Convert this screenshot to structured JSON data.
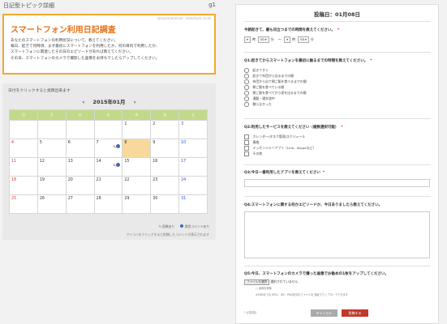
{
  "header": {
    "title": "日記型トピック詳細",
    "group": "g1"
  },
  "notice": {
    "datetime": "2014/12/26 00:00 - 2015/01/31 23:59",
    "title": "スマートフォン利用日記調査",
    "lines": [
      "あなたのスマートフォンの利用状況について、教えてください。",
      "毎日、起きて何時頃、まず最初にスマートフォンを利用したか、何の目的で利用したか、",
      "スマートフォンに関連したその日のエピソードがあれば教えてください。",
      "その日、スマートフォンのカメラで撮影した画像をお持ちでしたらアップしてください。"
    ]
  },
  "calendar": {
    "hint": "日付をクリックすると投稿出来ます",
    "prev": "‹",
    "month": "2015年01月",
    "next": "›",
    "weekdays": [
      "日",
      "月",
      "火",
      "水",
      "木",
      "金",
      "土"
    ],
    "weeks": [
      [
        "",
        "",
        "",
        "",
        "1",
        "2",
        "3"
      ],
      [
        "4",
        "5",
        "6",
        "7",
        "8",
        "9",
        "10"
      ],
      [
        "11",
        "12",
        "13",
        "14",
        "15",
        "16",
        "17"
      ],
      [
        "18",
        "19",
        "20",
        "21",
        "22",
        "23",
        "24"
      ],
      [
        "25",
        "26",
        "27",
        "28",
        "29",
        "30",
        "31"
      ]
    ],
    "legend_posted": "投稿あり",
    "legend_comment": "運営コメントあり",
    "note": "アイコンをクリックすると投稿したコメントが表示されます"
  },
  "form": {
    "title": "投稿日：01月08日",
    "q1": "今朝起きて、最も目立つまでの時間を教えてください。",
    "q1_selects": [
      "時",
      "分",
      "時",
      "分"
    ],
    "q1_sep": "〜",
    "q2": "Q1:起きてからスマートフォンを最初に触るまでの時間を教えてください。",
    "q2_options": [
      "起きてすぐ",
      "起きて布団から出るまでの間",
      "布団から出て朝ご飯を食べるまでの間",
      "朝ご飯を食べている間",
      "朝ご飯を食べてから家を出るまでの間",
      "通勤・通学途中",
      "触らなかった"
    ],
    "q3": "Q2:利用したサービスを教えてください（複数選択可能）",
    "q3_options": [
      "カレンダー/タスク管理/スケジュール",
      "連絡",
      "メッセンジャーアプリ（Line、Skypeなど）",
      "その他"
    ],
    "q4": "Q3:今日一番利用したアプリを教えてください",
    "q5": "Q4:スマートフォンに関する何かエピソードか、今日ありましたら教えてください。",
    "q6": "Q5:今日、スマートフォンのカメラで撮った画像でお勧めの1枚をアップしてください。",
    "file_button": "ファイルを選択",
    "file_status": "選択されていません",
    "file_note1": "画像を削除",
    "file_note2": "※2MBまでの JPEG、GIF、PNG形式のファイルを 指定でアップロードできます",
    "required_note": "* 必須項目",
    "required_mark": "*",
    "cancel": "キャンセル",
    "submit": "投稿する"
  }
}
